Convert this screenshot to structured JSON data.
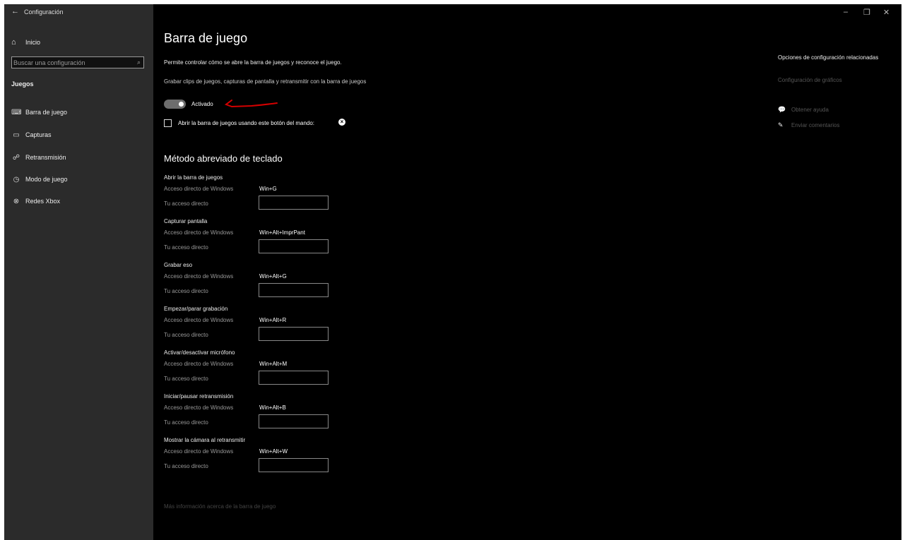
{
  "titlebar": {
    "back_icon": "back-arrow-icon",
    "title": "Configuración",
    "minimize": "–",
    "restore": "❐",
    "close": "✕"
  },
  "sidebar": {
    "home_label": "Inicio",
    "search_placeholder": "Buscar una configuración",
    "section": "Juegos",
    "items": [
      {
        "label": "Barra de juego",
        "icon": "gamebar-icon",
        "selected": true
      },
      {
        "label": "Capturas",
        "icon": "captures-icon",
        "selected": false
      },
      {
        "label": "Retransmisión",
        "icon": "broadcast-icon",
        "selected": false
      },
      {
        "label": "Modo de juego",
        "icon": "game-mode-icon",
        "selected": false
      },
      {
        "label": "Redes Xbox",
        "icon": "xbox-icon",
        "selected": false
      }
    ]
  },
  "main": {
    "title": "Barra de juego",
    "description": "Permite controlar cómo se abre la barra de juegos y reconoce el juego.",
    "record_text": "Grabar clips de juegos, capturas de pantalla y retransmitir con la barra de juegos",
    "toggle_label": "Activado",
    "toggle_on": true,
    "checkbox_label": "Abrir la barra de juegos usando este botón del mando:",
    "checkbox_checked": false,
    "shortcuts_title": "Método abreviado de teclado",
    "win_label": "Acceso directo de Windows",
    "your_label": "Tu acceso directo",
    "shortcuts": [
      {
        "title": "Abrir la barra de juegos",
        "win": "Win+G"
      },
      {
        "title": "Capturar pantalla",
        "win": "Win+Alt+ImprPant"
      },
      {
        "title": "Grabar eso",
        "win": "Win+Alt+G"
      },
      {
        "title": "Empezar/parar grabación",
        "win": "Win+Alt+R"
      },
      {
        "title": "Activar/desactivar micrófono",
        "win": "Win+Alt+M"
      },
      {
        "title": "Iniciar/pausar retransmisión",
        "win": "Win+Alt+B"
      },
      {
        "title": "Mostrar la cámara al retransmitir",
        "win": "Win+Alt+W"
      }
    ],
    "more_link": "Más información acerca de la barra de juego"
  },
  "related": {
    "title": "Opciones de configuración relacionadas",
    "link": "Configuración de gráficos",
    "help": "Obtener ayuda",
    "feedback": "Enviar comentarios"
  },
  "colors": {
    "background": "#000000",
    "sidebar": "#2b2b2b",
    "annotation": "#d40000"
  }
}
